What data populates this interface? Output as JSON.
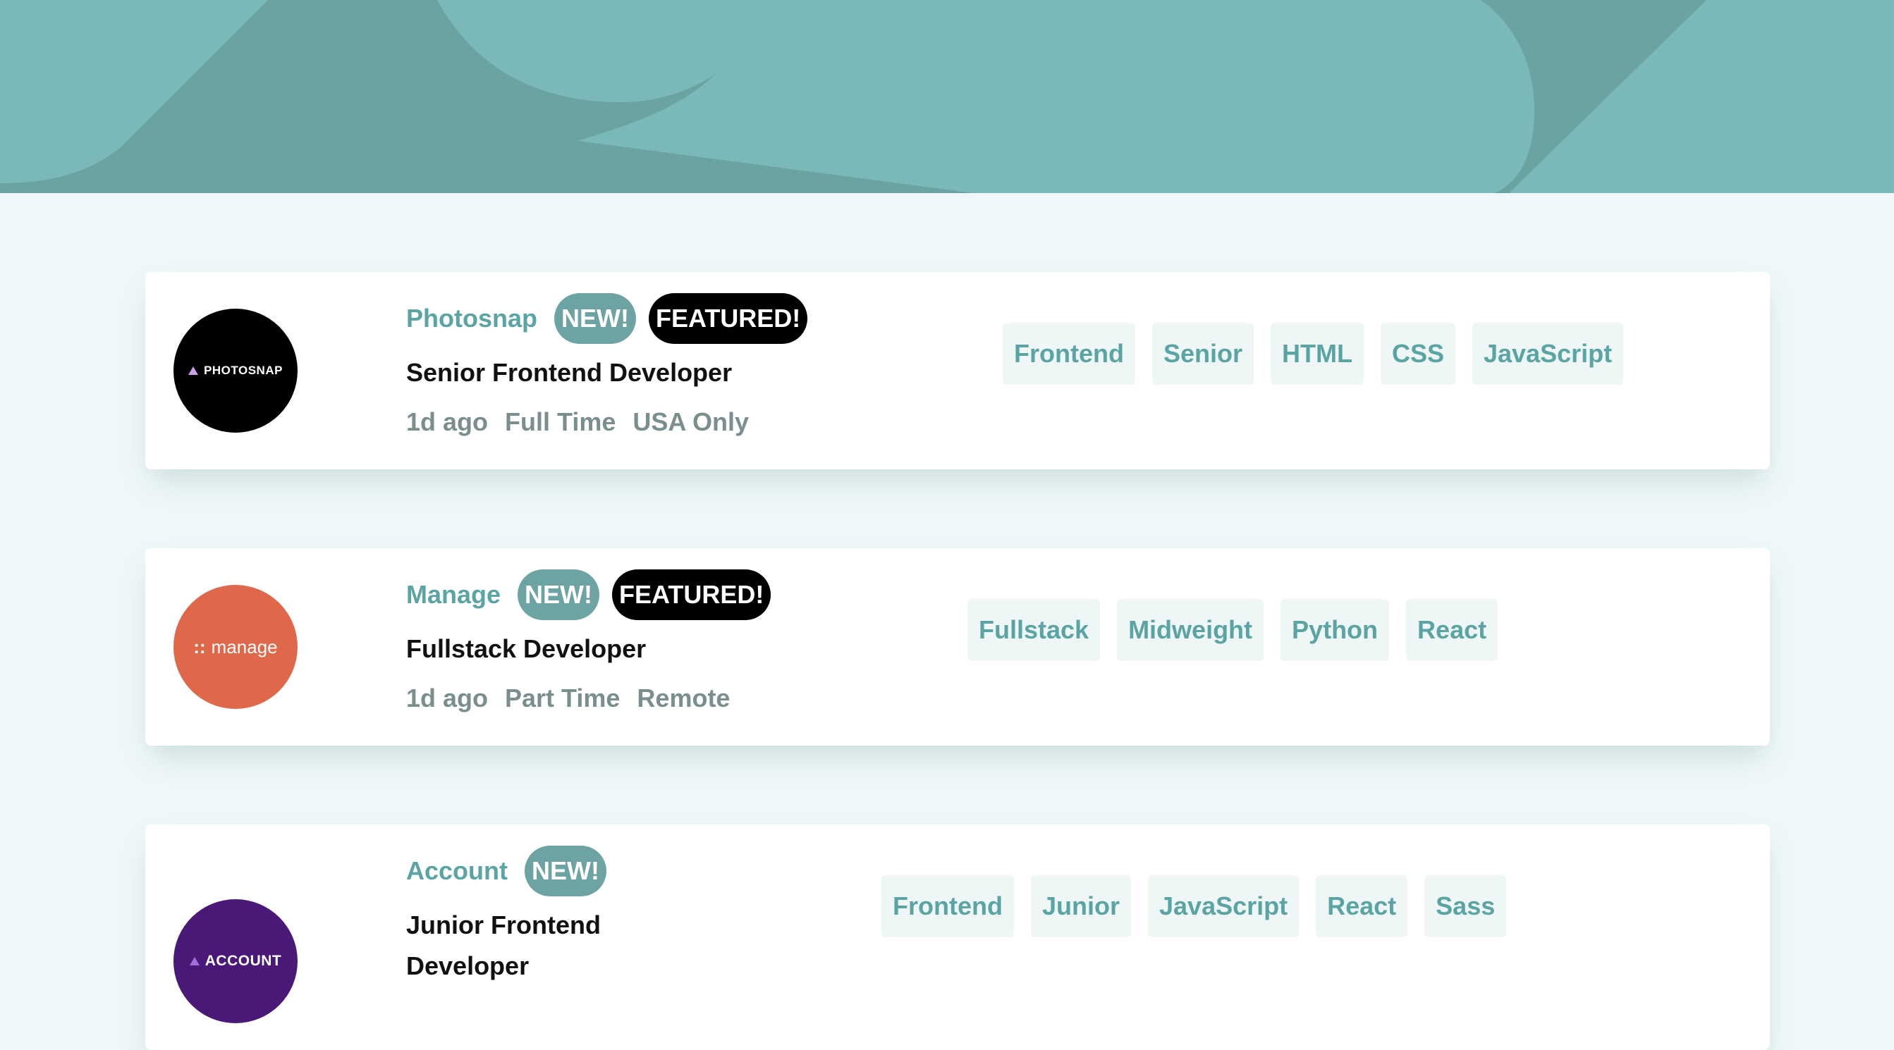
{
  "colors": {
    "background": "#eff8f8",
    "header": "#7bb9b9",
    "header_shape_dark": "#6ba3a3",
    "primary": "#5ba4a4",
    "tag_bg": "#eef6f6",
    "new_badge": "#6da3a3",
    "featured_badge": "#000000",
    "muted": "#7b8e8e"
  },
  "jobs": [
    {
      "logo": {
        "text": "PHOTOSNAP",
        "icon": "triangle-icon",
        "bg": "#000000"
      },
      "company": "Photosnap",
      "badges": {
        "new": "NEW!",
        "featured": "FEATURED!"
      },
      "position": "Senior Frontend Developer",
      "posted": "1d ago",
      "contract": "Full Time",
      "location": "USA Only",
      "tags": [
        "Frontend",
        "Senior",
        "HTML",
        "CSS",
        "JavaScript"
      ]
    },
    {
      "logo": {
        "dots": "::",
        "text": "manage",
        "bg": "#e0684a"
      },
      "company": "Manage",
      "badges": {
        "new": "NEW!",
        "featured": "FEATURED!"
      },
      "position": "Fullstack Developer",
      "posted": "1d ago",
      "contract": "Part Time",
      "location": "Remote",
      "tags": [
        "Fullstack",
        "Midweight",
        "Python",
        "React"
      ]
    },
    {
      "logo": {
        "text": "ACCOUNT",
        "icon": "mountain-icon",
        "bg": "#4a1978"
      },
      "company": "Account",
      "badges": {
        "new": "NEW!"
      },
      "position": "Junior Frontend Developer",
      "tags": [
        "Frontend",
        "Junior",
        "JavaScript",
        "React",
        "Sass"
      ]
    }
  ]
}
